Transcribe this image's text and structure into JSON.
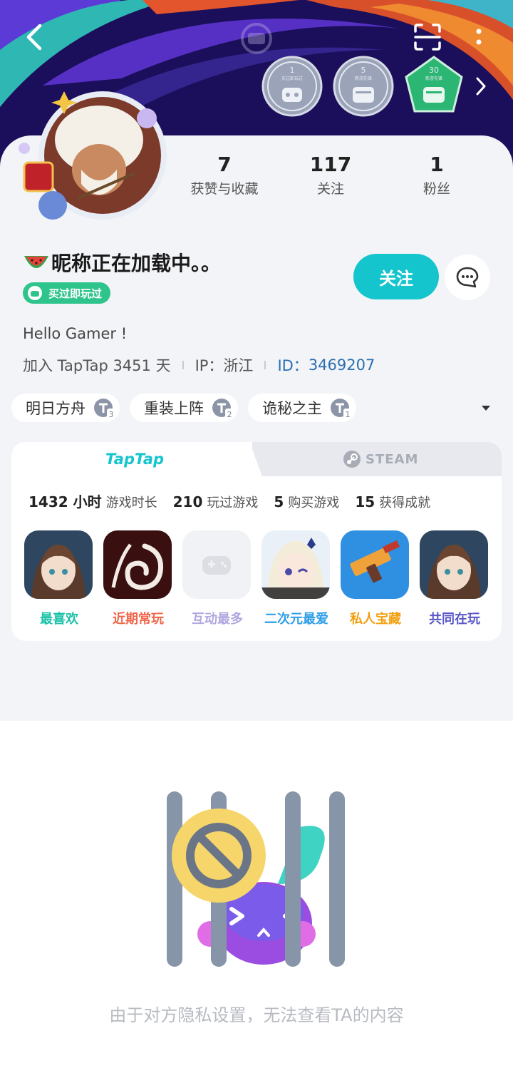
{
  "colors": {
    "accent": "#15c5ce",
    "verified_green": "#2ec48b",
    "banner_navy": "#1b0f5c",
    "card_bg": "#f3f4f7"
  },
  "header": {
    "back_icon": "back-arrow-icon",
    "scan_icon": "scan-icon",
    "more_icon": "more-vertical-icon"
  },
  "badges": [
    {
      "num": "1",
      "sub": "买过即玩过"
    },
    {
      "num": "5",
      "sub": "新游先锋"
    },
    {
      "num": "30",
      "sub": "新游先锋"
    }
  ],
  "stats": [
    {
      "value": "7",
      "label": "获赞与收藏"
    },
    {
      "value": "117",
      "label": "关注"
    },
    {
      "value": "1",
      "label": "粉丝"
    }
  ],
  "profile": {
    "nickname": "昵称正在加载中。。",
    "verified_badge": "买过即玩过",
    "follow_label": "关注",
    "bio": "Hello Gamer !",
    "join_text": "加入 TapTap 3451 天",
    "ip_text": "IP：浙江",
    "id_label": "ID：",
    "id_value": "3469207"
  },
  "tags": [
    {
      "name": "明日方舟",
      "level": "3"
    },
    {
      "name": "重装上阵",
      "level": "2"
    },
    {
      "name": "诡秘之主",
      "level": "1"
    }
  ],
  "tabs": {
    "taptap": "TapTap",
    "steam": "STEAM"
  },
  "game_stats": [
    {
      "value": "1432 小时",
      "label": "游戏时长"
    },
    {
      "value": "210",
      "label": "玩过游戏"
    },
    {
      "value": "5",
      "label": "购买游戏"
    },
    {
      "value": "15",
      "label": "获得成就"
    }
  ],
  "games": [
    {
      "label": "最喜欢",
      "color": "#1cc2a8"
    },
    {
      "label": "近期常玩",
      "color": "#f0664a"
    },
    {
      "label": "互动最多",
      "color": "#b0a8e0"
    },
    {
      "label": "二次元最爱",
      "color": "#2f9fe8"
    },
    {
      "label": "私人宝藏",
      "color": "#f2a011"
    },
    {
      "label": "共同在玩",
      "color": "#5a58c8"
    }
  ],
  "privacy": {
    "message": "由于对方隐私设置，无法查看TA的内容"
  }
}
